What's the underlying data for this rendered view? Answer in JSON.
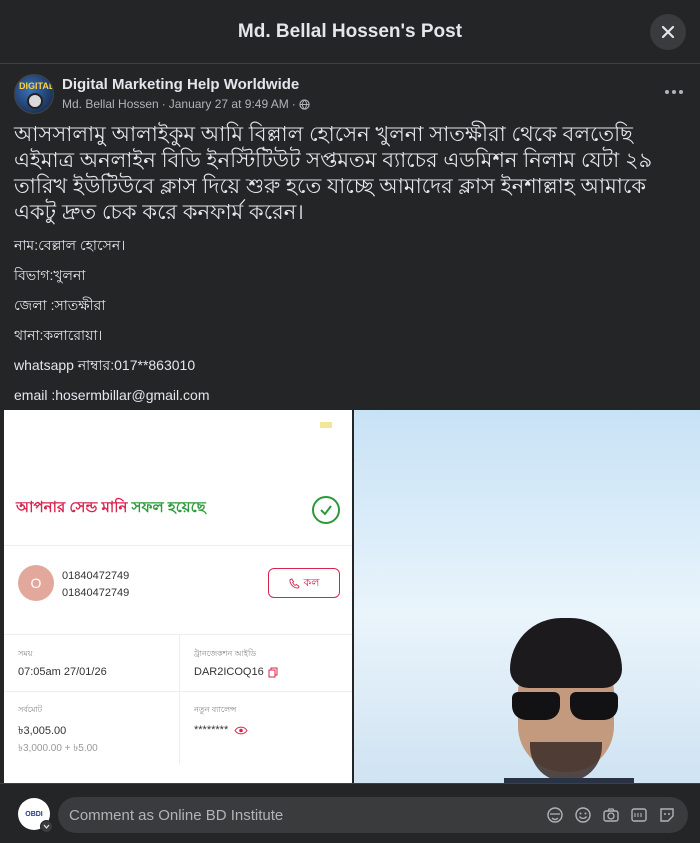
{
  "modal": {
    "title": "Md. Bellal Hossen's Post"
  },
  "post": {
    "group_name": "Digital Marketing Help Worldwide",
    "author": "Md. Bellal Hossen",
    "sep": "·",
    "time": "January 27 at 9:49 AM",
    "sep2": "·",
    "avatar_text": "DIGITAL",
    "headline": "আসসালামু আলাইকুম আমি বিল্লাল হোসেন খুলনা সাতক্ষীরা থেকে বলতেছি এইমাত্র অনলাইন বিডি ইনস্টিটিউট সপ্তমতম ব্যাচের এডমিশন নিলাম যেটা ২৯ তারিখ ইউটিউবে ক্লাস দিয়ে শুরু হতে যাচ্ছে আমাদের ক্লাস ইনশাল্লাহ আমাকে একটু দ্রুত চেক করে কনফার্ম করেন।",
    "lines": [
      "নাম:বেল্লাল হোসেন।",
      "বিভাগ:খুলনা",
      "জেলা :সাতক্ষীরা",
      "থানা:কলারোয়া।",
      "whatsapp নাম্বার:017**863010",
      "email :hosermbillar@gmail.com"
    ]
  },
  "receipt": {
    "success_p1": "আপনার ",
    "success_p2": "সেন্ড মানি ",
    "success_p3": "সফল হয়েছে",
    "contact_initial": "O",
    "number_1": "01840472749",
    "number_2": "01840472749",
    "call_label": "কল",
    "time_label": "সময়",
    "time_value": "07:05am 27/01/26",
    "txn_label": "ট্রানজেকশন আইডি",
    "txn_value": "DAR2ICOQ16",
    "total_label": "সর্বমোট",
    "total_value": "৳3,005.00",
    "total_breakdown": "৳3,000.00 + ৳5.00",
    "balance_label": "নতুন ব্যালেন্স",
    "balance_value": "********"
  },
  "comment": {
    "placeholder": "Comment as Online BD Institute",
    "avatar_text": "OBDI"
  },
  "icons": [
    "close-icon",
    "globe-icon",
    "more-icon",
    "check-icon",
    "phone-icon",
    "copy-icon",
    "eye-icon",
    "chevron-down-icon",
    "avatar-sticker-icon",
    "emoji-icon",
    "camera-icon",
    "gif-icon",
    "sticker-icon"
  ],
  "colors": {
    "background": "#242526",
    "receipt_accent": "#d9254e",
    "success_green": "#2c9a3b"
  }
}
